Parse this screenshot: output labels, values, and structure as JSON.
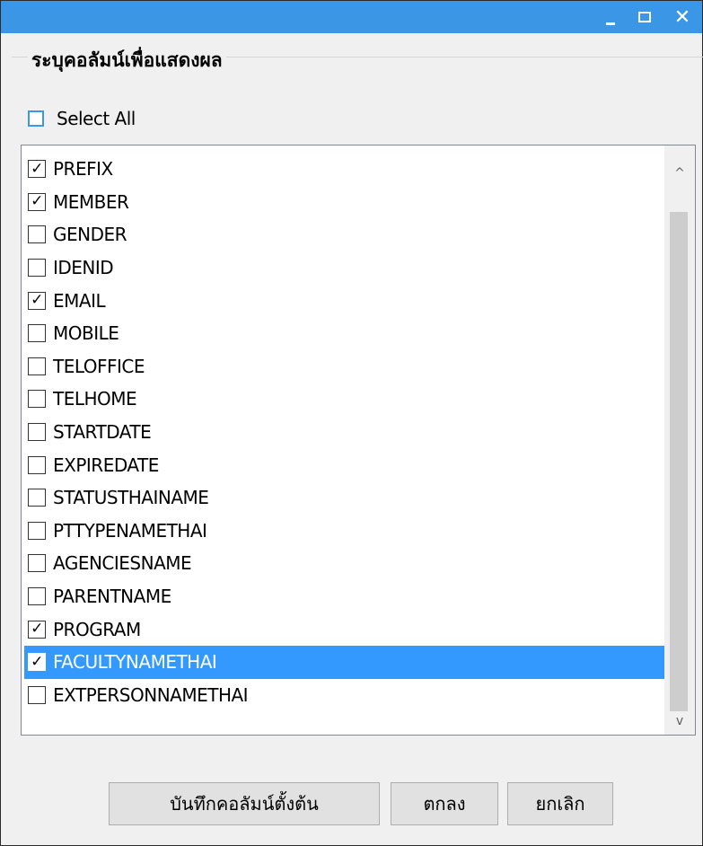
{
  "window": {
    "controls": {
      "minimize": "_",
      "maximize": "□",
      "close": "✕"
    }
  },
  "group": {
    "title": "ระบุคอลัมน์เพื่อแสดงผล"
  },
  "select_all": {
    "label": "Select All",
    "checked": false
  },
  "columns": [
    {
      "label": "PREFIX",
      "checked": true,
      "selected": false
    },
    {
      "label": "MEMBER",
      "checked": true,
      "selected": false
    },
    {
      "label": "GENDER",
      "checked": false,
      "selected": false
    },
    {
      "label": "IDENID",
      "checked": false,
      "selected": false
    },
    {
      "label": "EMAIL",
      "checked": true,
      "selected": false
    },
    {
      "label": "MOBILE",
      "checked": false,
      "selected": false
    },
    {
      "label": "TELOFFICE",
      "checked": false,
      "selected": false
    },
    {
      "label": "TELHOME",
      "checked": false,
      "selected": false
    },
    {
      "label": "STARTDATE",
      "checked": false,
      "selected": false
    },
    {
      "label": "EXPIREDATE",
      "checked": false,
      "selected": false
    },
    {
      "label": "STATUSTHAINAME",
      "checked": false,
      "selected": false
    },
    {
      "label": "PTTYPENAMETHAI",
      "checked": false,
      "selected": false
    },
    {
      "label": "AGENCIESNAME",
      "checked": false,
      "selected": false
    },
    {
      "label": "PARENTNAME",
      "checked": false,
      "selected": false
    },
    {
      "label": "PROGRAM",
      "checked": true,
      "selected": false
    },
    {
      "label": "FACULTYNAMETHAI",
      "checked": true,
      "selected": true
    },
    {
      "label": "EXTPERSONNAMETHAI",
      "checked": false,
      "selected": false
    }
  ],
  "scroll": {
    "up": "^",
    "down": "v"
  },
  "buttons": {
    "save_default": "บันทึกคอลัมน์ตั้งต้น",
    "ok": "ตกลง",
    "cancel": "ยกเลิก"
  },
  "colors": {
    "titlebar": "#3b97e6",
    "selection": "#3399ff",
    "checkbox_accent": "#3b97e6"
  }
}
